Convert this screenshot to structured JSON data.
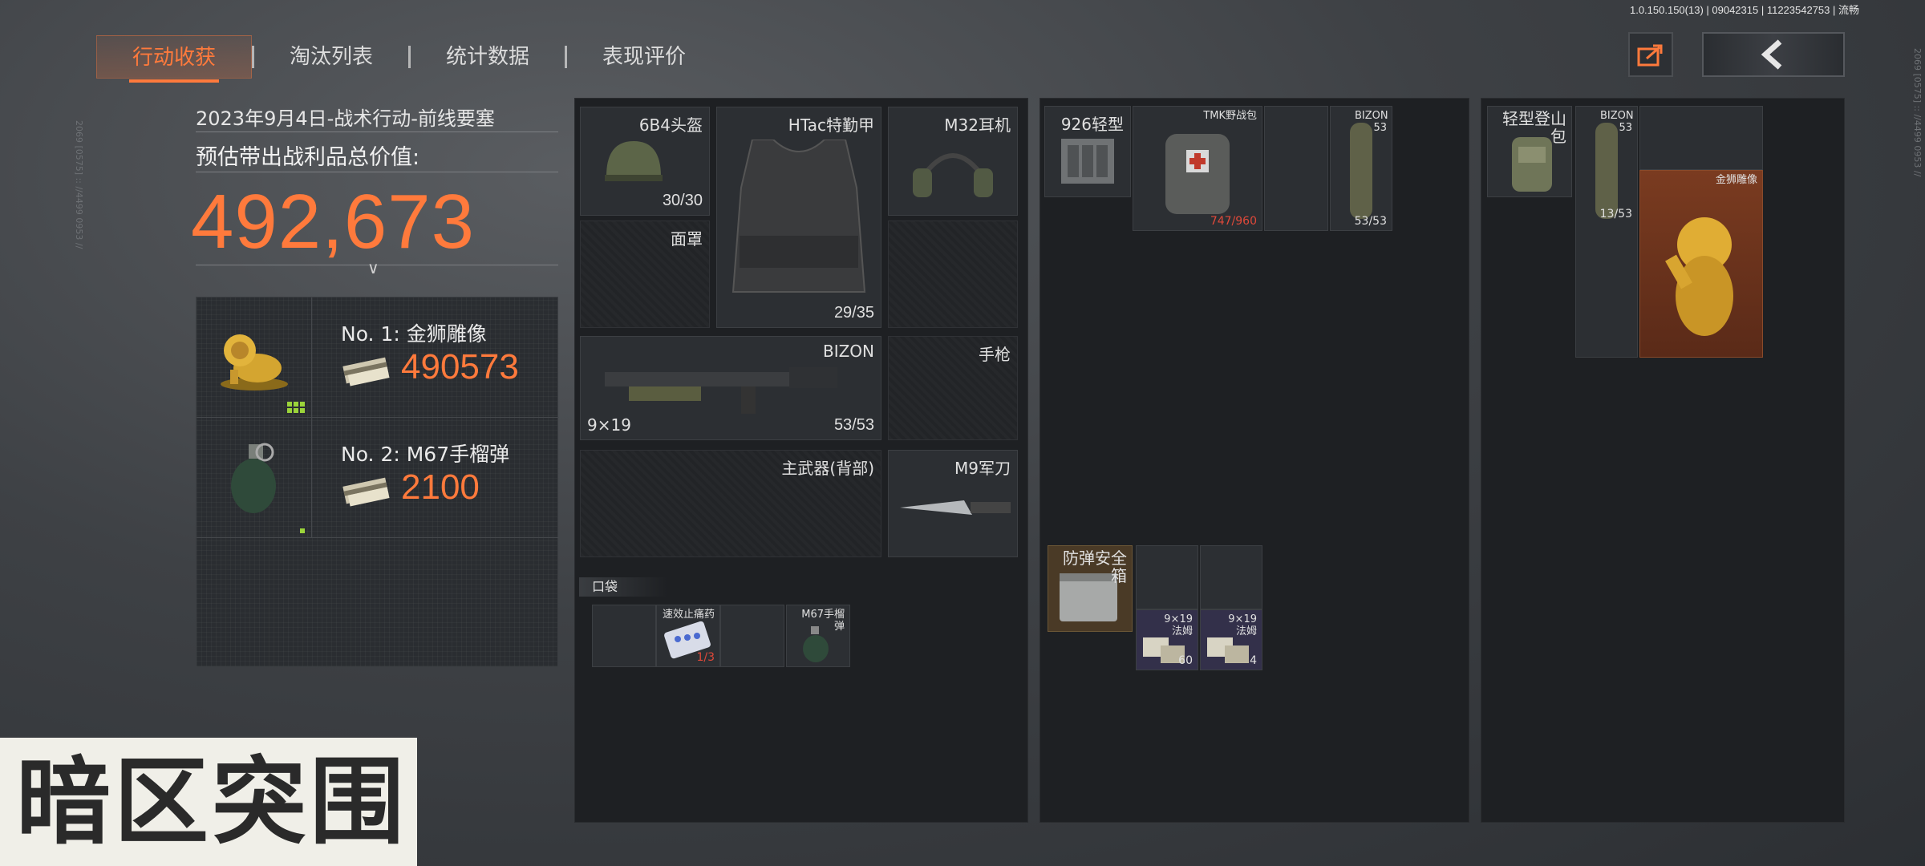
{
  "version": "1.0.150.150(13) | 09042315 | 11223542753 | 流畅",
  "tabs": [
    {
      "label": "行动收获",
      "active": true
    },
    {
      "label": "淘汰列表",
      "active": false
    },
    {
      "label": "统计数据",
      "active": false
    },
    {
      "label": "表现评价",
      "active": false
    }
  ],
  "summary": {
    "date_line": "2023年9月4日-战术行动-前线要塞",
    "estimate_label": "预估带出战利品总价值:",
    "total_value": "492,673"
  },
  "top_items": [
    {
      "name": "No. 1: 金狮雕像",
      "value": "490573"
    },
    {
      "name": "No. 2: M67手榴弹",
      "value": "2100"
    }
  ],
  "equipment": {
    "helmet": {
      "label": "6B4头盔",
      "count": "30/30"
    },
    "armor": {
      "label": "HTac特勤甲",
      "count": "29/35"
    },
    "headset": {
      "label": "M32耳机"
    },
    "mask": {
      "label": "面罩"
    },
    "primary": {
      "label": "BIZON",
      "caliber": "9×19",
      "count": "53/53"
    },
    "pistol": {
      "label": "手枪"
    },
    "back_weapon": {
      "label": "主武器(背部)"
    },
    "knife": {
      "label": "M9军刀"
    },
    "pocket_label": "口袋",
    "pocket_items": [
      {
        "label": "速效止痛药",
        "count": "1/3"
      },
      {
        "label": "M67手榴弹"
      }
    ]
  },
  "rig": {
    "name": "926轻型",
    "items": [
      {
        "label": "TMK野战包",
        "count": "747/960"
      },
      {
        "label": "BIZON 53",
        "count": "53/53"
      }
    ],
    "case": {
      "label": "防弹安全箱"
    },
    "case_items": [
      {
        "label": "9×19 法姆",
        "count": "60"
      },
      {
        "label": "9×19 法姆",
        "count": "4"
      }
    ]
  },
  "backpack": {
    "name": "轻型登山包",
    "items": [
      {
        "label": "BIZON 53",
        "count": "13/53"
      },
      {
        "label": "金狮雕像"
      }
    ]
  },
  "logo_text": "暗区突围",
  "colors": {
    "accent": "#ff7a3c",
    "panel": "#1e2023",
    "gold_bg": "#6a3420"
  }
}
